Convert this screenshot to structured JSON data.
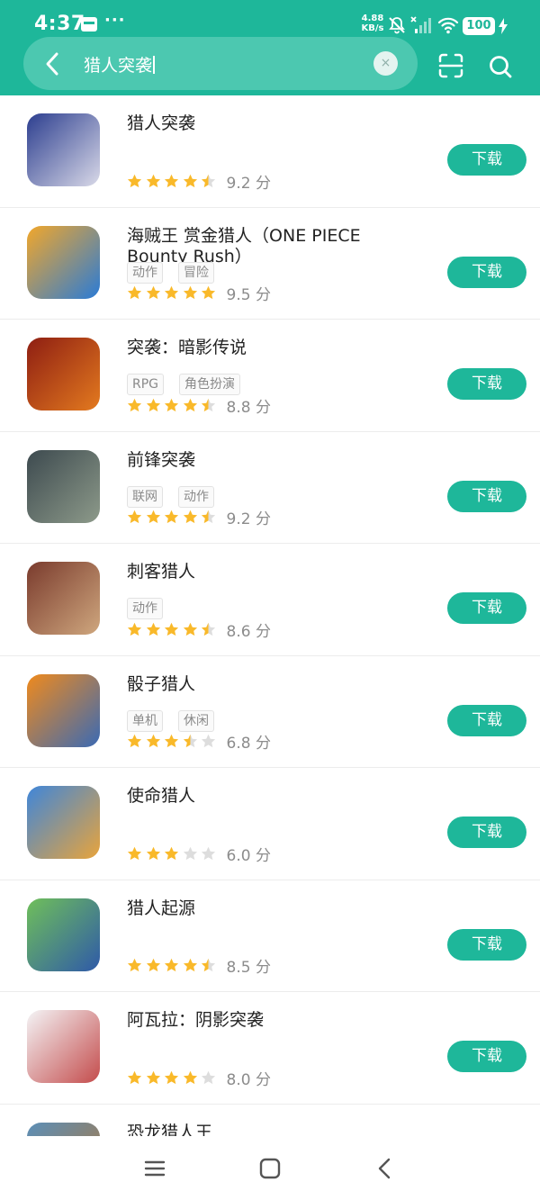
{
  "status_bar": {
    "time": "4:37",
    "dots": "···",
    "net_speed_value": "4.88",
    "net_speed_unit": "KB/s",
    "battery": "100"
  },
  "search": {
    "query": "猎人突袭",
    "clear_symbol": "×"
  },
  "download_label": "下载",
  "score_unit": "分",
  "theme": {
    "accent": "#1eb79a",
    "star": "#f9b92a",
    "star_empty": "#dddddd"
  },
  "apps": [
    {
      "name": "猎人突袭",
      "tags": [],
      "score": "9.2",
      "stars": 4.5,
      "icon_name": "hunter-raid-icon",
      "icon_colors": [
        "#2c3e8f",
        "#d9d9e8"
      ]
    },
    {
      "name": "海贼王 赏金猎人（ONE PIECE Bounty Rush）",
      "tags": [
        "动作",
        "冒险"
      ],
      "score": "9.5",
      "stars": 5,
      "icon_name": "one-piece-bounty-rush-icon",
      "icon_colors": [
        "#f2a72a",
        "#2a7bd6"
      ]
    },
    {
      "name": "突袭：暗影传说",
      "tags": [
        "RPG",
        "角色扮演"
      ],
      "score": "8.8",
      "stars": 4.5,
      "icon_name": "raid-shadow-legends-icon",
      "icon_colors": [
        "#8e1e12",
        "#e37a1f"
      ]
    },
    {
      "name": "前锋突袭",
      "tags": [
        "联网",
        "动作"
      ],
      "score": "9.2",
      "stars": 4.5,
      "icon_name": "vanguard-raid-icon",
      "icon_colors": [
        "#3d4a4f",
        "#8d9a8a"
      ]
    },
    {
      "name": "刺客猎人",
      "tags": [
        "动作"
      ],
      "score": "8.6",
      "stars": 4.5,
      "icon_name": "assassin-hunter-icon",
      "icon_colors": [
        "#7a3b2d",
        "#cfa77e"
      ]
    },
    {
      "name": "骰子猎人",
      "tags": [
        "单机",
        "休闲"
      ],
      "score": "6.8",
      "stars": 3.5,
      "icon_name": "dice-hunter-icon",
      "icon_colors": [
        "#f08a1c",
        "#3a6ab4"
      ]
    },
    {
      "name": "使命猎人",
      "tags": [],
      "score": "6.0",
      "stars": 3,
      "icon_name": "mission-hunter-icon",
      "icon_colors": [
        "#3f86d9",
        "#e8a43c"
      ]
    },
    {
      "name": "猎人起源",
      "tags": [],
      "score": "8.5",
      "stars": 4.5,
      "icon_name": "hunter-origin-icon",
      "icon_colors": [
        "#6fbf5a",
        "#2f5aa8"
      ]
    },
    {
      "name": "阿瓦拉：阴影突袭",
      "tags": [],
      "score": "8.0",
      "stars": 4,
      "icon_name": "avalar-shadow-raid-icon",
      "icon_colors": [
        "#f4f4f6",
        "#c44c4c"
      ]
    },
    {
      "name": "恐龙猎人王",
      "tags": [],
      "score": "",
      "stars": 0,
      "icon_name": "dino-hunter-king-icon",
      "icon_colors": [
        "#5b8fb8",
        "#b0773a"
      ]
    }
  ]
}
